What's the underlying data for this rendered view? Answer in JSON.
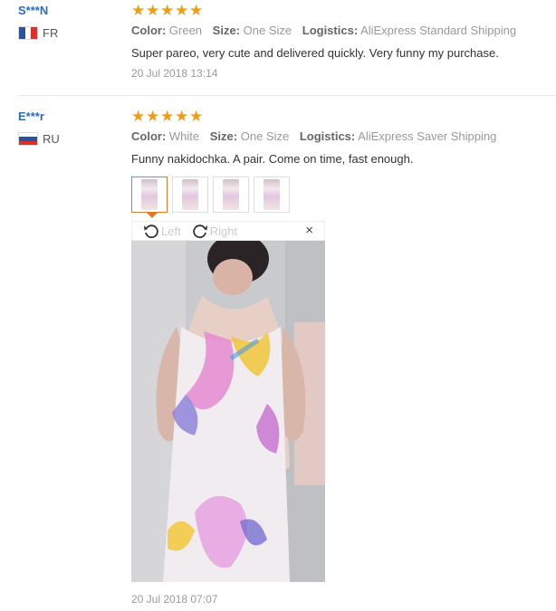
{
  "reviews": [
    {
      "user": "S***N",
      "country": "FR",
      "rating": 5,
      "attributes": [
        {
          "label": "Color:",
          "value": "Green"
        },
        {
          "label": "Size:",
          "value": "One Size"
        },
        {
          "label": "Logistics:",
          "value": "AliExpress Standard Shipping"
        }
      ],
      "text": "Super pareo, very cute and delivered quickly. Very funny my purchase.",
      "date": "20 Jul 2018 13:14"
    },
    {
      "user": "E***r",
      "country": "RU",
      "rating": 5,
      "attributes": [
        {
          "label": "Color:",
          "value": "White"
        },
        {
          "label": "Size:",
          "value": "One Size"
        },
        {
          "label": "Logistics:",
          "value": "AliExpress Saver Shipping"
        }
      ],
      "text": "Funny nakidochka. A pair. Come on time, fast enough.",
      "date": "20 Jul 2018 07:07",
      "viewer": {
        "rotate_left": "Left",
        "rotate_right": "Right",
        "close": "×"
      }
    }
  ],
  "colors": {
    "star": "#f39c12",
    "username": "#2a6ebb",
    "active_thumb": "#e0782a"
  },
  "icons": [
    "star-icon",
    "flag-fr-icon",
    "flag-ru-icon",
    "rotate-left-icon",
    "rotate-right-icon",
    "close-icon"
  ]
}
